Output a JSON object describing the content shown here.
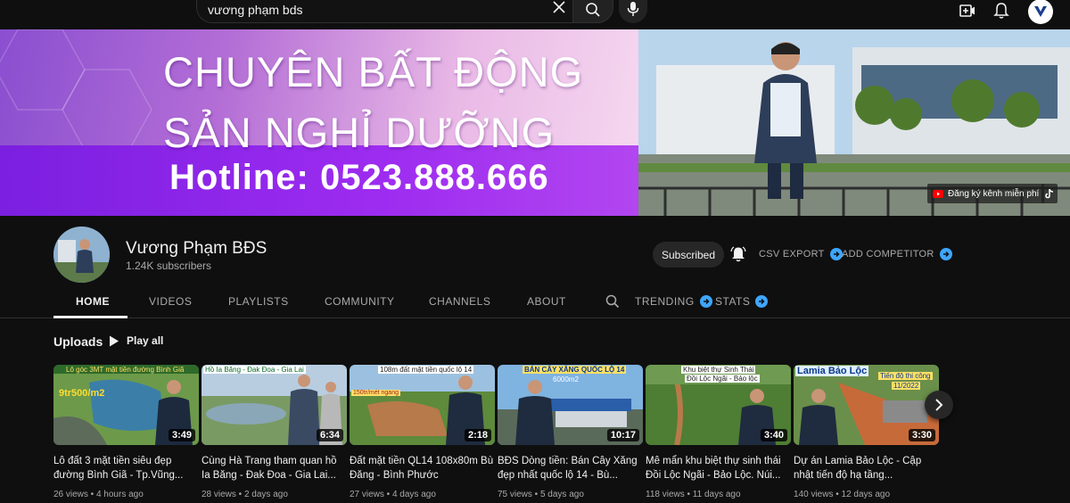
{
  "search": {
    "query": "vương phạm bds"
  },
  "icons": {
    "clear": "close-icon",
    "search": "search-icon",
    "mic": "mic-icon",
    "create": "create-video-icon",
    "notifications": "bell-icon",
    "account": "account-avatar"
  },
  "banner": {
    "line1": "CHUYÊN BẤT ĐỘNG",
    "line2": "SẢN NGHỈ DƯỠNG",
    "hotline": "Hotline: 0523.888.666",
    "cta": "Đăng ký kênh miễn phí"
  },
  "channel": {
    "name": "Vương Phạm BĐS",
    "subscribers": "1.24K subscribers",
    "subscribed_label": "Subscribed",
    "csv_export": "CSV EXPORT",
    "add_competitor": "ADD COMPETITOR"
  },
  "tabs": {
    "home": "HOME",
    "videos": "VIDEOS",
    "playlists": "PLAYLISTS",
    "community": "COMMUNITY",
    "channels": "CHANNELS",
    "about": "ABOUT",
    "trending": "TRENDING",
    "stats": "STATS"
  },
  "uploads": {
    "title": "Uploads",
    "play_all": "Play all"
  },
  "videos": [
    {
      "title": "Lô đất 3 mặt tiền siêu đẹp đường Bình Giã - Tp.Vũng...",
      "views": "26 views",
      "age": "4 hours ago",
      "duration": "3:49",
      "overlay_top": "Lô góc 3MT mặt tiền đường Bình Giã",
      "overlay_price": "9tr500/m2"
    },
    {
      "title": "Cùng Hà Trang tham quan hồ Ia Băng - Đak Đoa - Gia Lai...",
      "views": "28 views",
      "age": "2 days ago",
      "duration": "6:34",
      "overlay_top": "Hồ Ia Băng - Đak Đoa - Gia Lai"
    },
    {
      "title": "Đất mặt tiền QL14 108x80m Bù Đăng - Bình Phước",
      "views": "27 views",
      "age": "4 days ago",
      "duration": "2:18",
      "overlay_top": "108m đất mặt tiền quốc lộ 14",
      "overlay_price": "150tr/mét ngang"
    },
    {
      "title": "BĐS Dòng tiền: Bán Cây Xăng đẹp nhất quốc lộ 14 - Bù...",
      "views": "75 views",
      "age": "5 days ago",
      "duration": "10:17",
      "overlay_top": "BÁN CÂY XĂNG QUỐC LỘ 14",
      "overlay_price": "6000m2"
    },
    {
      "title": "Mê mẩn khu biệt thự sinh thái Đồi Lộc Ngãi - Bảo Lộc. Núi...",
      "views": "118 views",
      "age": "11 days ago",
      "duration": "3:40",
      "overlay_top": "Khu biệt thự Sinh Thái",
      "overlay_sub": "Đồi Lộc Ngãi - Bảo lộc"
    },
    {
      "title": "Dự án Lamia Bảo Lộc - Cập nhật tiến độ hạ tầng...",
      "views": "140 views",
      "age": "12 days ago",
      "duration": "3:30",
      "overlay_top": "Lamia Bảo Lộc",
      "overlay_sub": "Tiến độ thi công",
      "overlay_date": "11/2022"
    }
  ],
  "colors": {
    "accent_blue": "#3ea6ff",
    "background": "#0f0f0f",
    "banner_purple": "#9d2cf0"
  }
}
